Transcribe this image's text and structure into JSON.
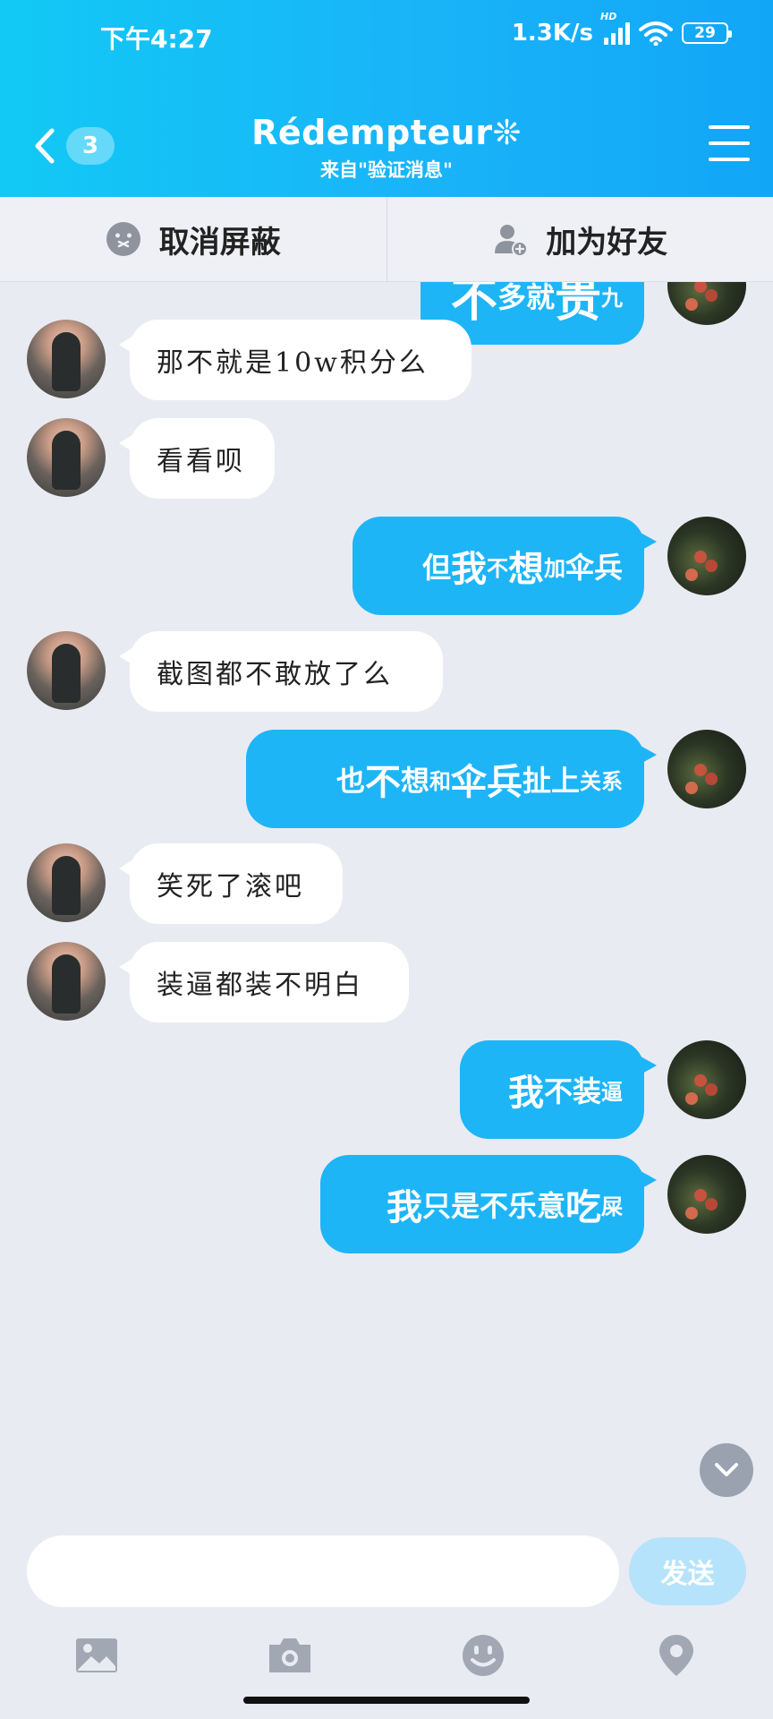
{
  "status_bar": {
    "time": "下午4:27",
    "net_speed": "1.3K/s",
    "hd_label": "HD",
    "battery": "29"
  },
  "header": {
    "unread_count": "3",
    "title": "Rédempteur❊",
    "subtitle": "来自\"验证消息\""
  },
  "actions": {
    "unblock_label": "取消屏蔽",
    "add_friend_label": "加为好友"
  },
  "messages": [
    {
      "side": "right",
      "segments": [
        [
          "不",
          "xl"
        ],
        [
          "多就",
          "m"
        ],
        [
          "贵",
          "xl"
        ],
        [
          "九",
          "s"
        ]
      ]
    },
    {
      "side": "left",
      "text": "那不就是10w积分么"
    },
    {
      "side": "left",
      "text": "看看呗"
    },
    {
      "side": "right",
      "segments": [
        [
          "但",
          "m"
        ],
        [
          "我",
          "l"
        ],
        [
          "不",
          "s"
        ],
        [
          "想",
          "l"
        ],
        [
          "加",
          "s"
        ],
        [
          "伞兵",
          "m"
        ]
      ]
    },
    {
      "side": "left",
      "text": "截图都不敢放了么"
    },
    {
      "side": "right",
      "segments": [
        [
          "也",
          "m"
        ],
        [
          "不",
          "l"
        ],
        [
          "想",
          "m"
        ],
        [
          "和",
          "s"
        ],
        [
          "伞兵",
          "l"
        ],
        [
          "扯",
          "m"
        ],
        [
          "上",
          "m"
        ],
        [
          "关系",
          "s"
        ]
      ]
    },
    {
      "side": "left",
      "text": "笑死了滚吧"
    },
    {
      "side": "left",
      "text": "装逼都装不明白"
    },
    {
      "side": "right",
      "segments": [
        [
          "我",
          "l"
        ],
        [
          "不装",
          "m"
        ],
        [
          "逼",
          "s"
        ]
      ]
    },
    {
      "side": "right",
      "segments": [
        [
          "我",
          "l"
        ],
        [
          "只是",
          "m"
        ],
        [
          "不乐意",
          "m"
        ],
        [
          "吃",
          "l"
        ],
        [
          "屎",
          "s"
        ]
      ]
    }
  ],
  "input": {
    "value": "",
    "send_label": "发送"
  },
  "colors": {
    "header_gradient_start": "#12c9f5",
    "header_gradient_end": "#12a6f7",
    "bubble_self": "#1eb5f7",
    "bubble_other": "#ffffff",
    "chat_background": "#e9ebf2",
    "send_disabled": "#b5e3fb"
  },
  "icons": [
    "back-chevron-icon",
    "menu-icon",
    "unblock-icon",
    "add-friend-icon",
    "image-icon",
    "camera-icon",
    "emoji-icon",
    "location-icon",
    "chevron-down-icon"
  ]
}
